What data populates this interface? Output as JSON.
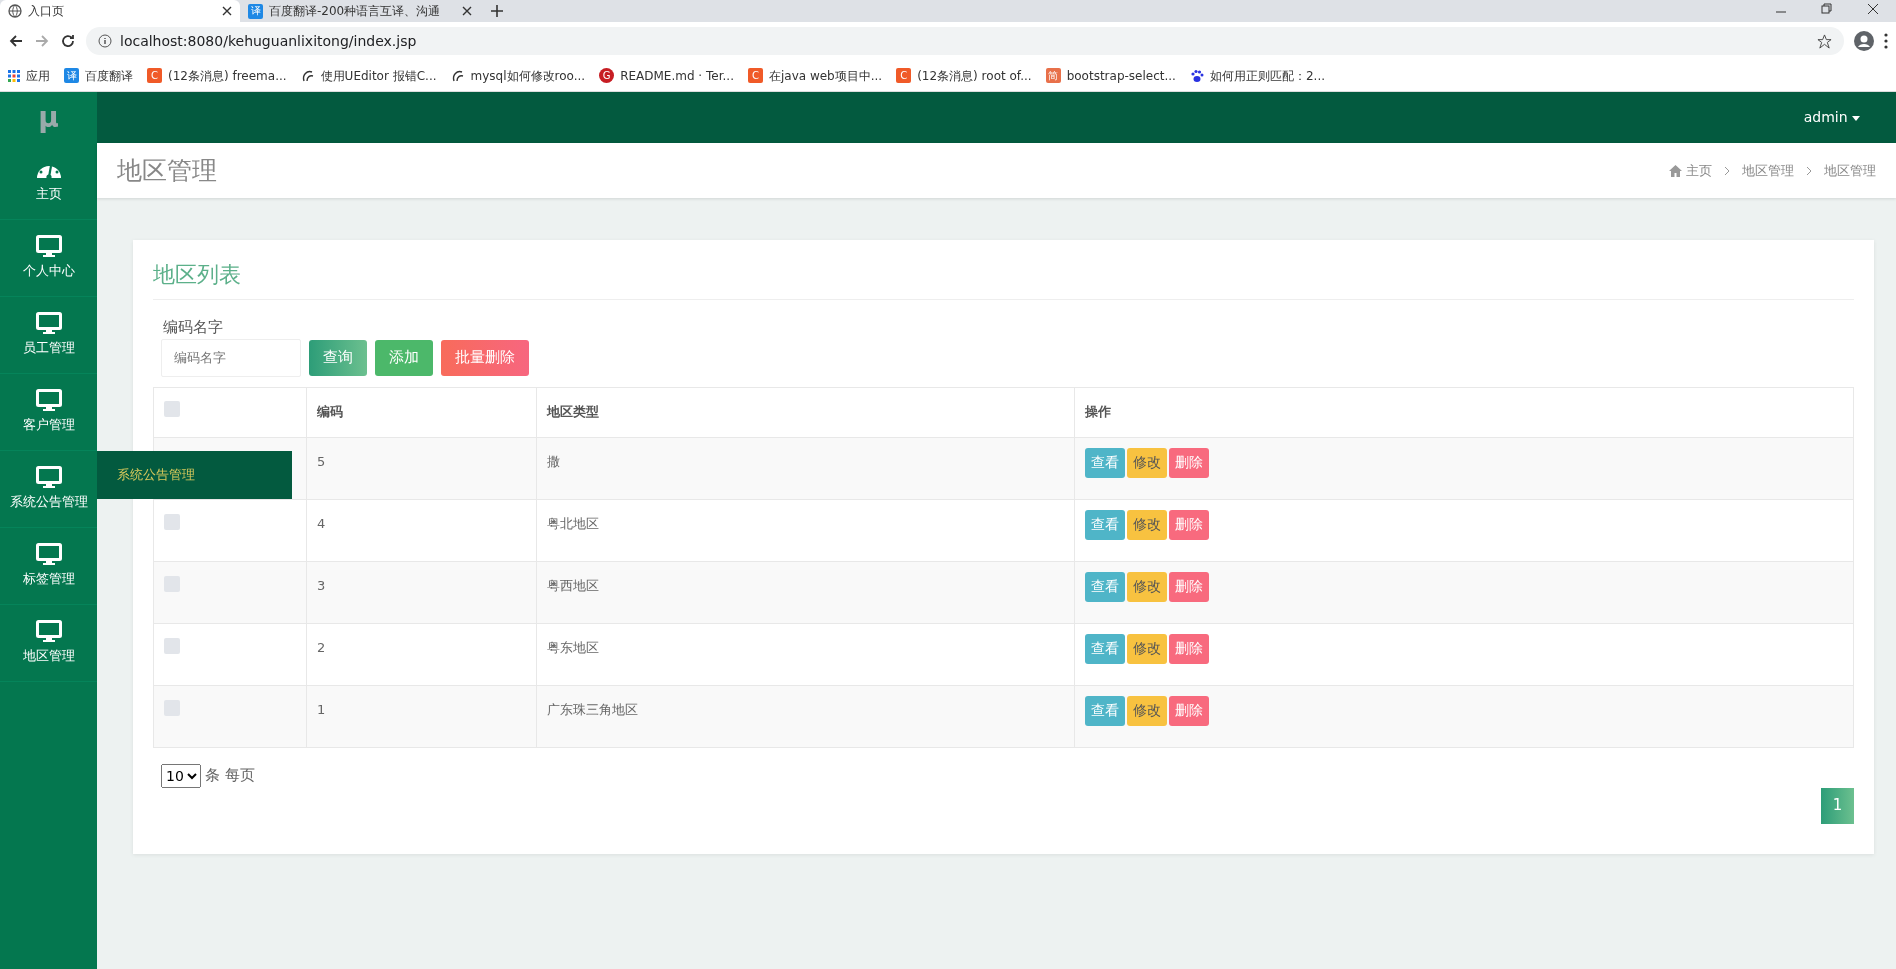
{
  "browser": {
    "tabs": [
      {
        "label": "入口页",
        "kind": "globe",
        "selected": true
      },
      {
        "label": "百度翻译-200种语言互译、沟通",
        "kind": "letter",
        "icon_text": "译",
        "selected": false
      }
    ],
    "address": "localhost:8080/kehuguanlixitong/index.jsp",
    "bookmarks": [
      {
        "kind": "grid",
        "label": "应用"
      },
      {
        "kind": "letter",
        "icon_text": "译",
        "color": "#1e88e5",
        "label": "百度翻译"
      },
      {
        "kind": "letter",
        "icon_text": "C",
        "color": "#f05a28",
        "label": "(12条消息) freema..."
      },
      {
        "kind": "ueditor",
        "label": "使用UEditor 报错C..."
      },
      {
        "kind": "ueditor",
        "label": "mysql如何修改roo..."
      },
      {
        "kind": "circle",
        "icon_text": "G",
        "color": "#c71d23",
        "label": "README.md · Ter..."
      },
      {
        "kind": "letter",
        "icon_text": "C",
        "color": "#f05a28",
        "label": "在java web项目中..."
      },
      {
        "kind": "letter",
        "icon_text": "C",
        "color": "#f05a28",
        "label": "(12条消息) root of..."
      },
      {
        "kind": "letter",
        "icon_text": "简",
        "color": "#e8704a",
        "label": "bootstrap-select..."
      },
      {
        "kind": "paw",
        "label": "如何用正则匹配：2..."
      }
    ]
  },
  "app": {
    "logo": "μ",
    "user": "admin",
    "sidebar": [
      {
        "kind": "dashboard",
        "label": "主页"
      },
      {
        "kind": "monitor",
        "label": "个人中心"
      },
      {
        "kind": "monitor",
        "label": "员工管理"
      },
      {
        "kind": "monitor",
        "label": "客户管理"
      },
      {
        "kind": "monitor",
        "label": "系统公告管理"
      },
      {
        "kind": "monitor",
        "label": "标签管理"
      },
      {
        "kind": "monitor",
        "label": "地区管理"
      }
    ],
    "flyout": "系统公告管理",
    "page_title": "地区管理",
    "breadcrumb": [
      "主页",
      "地区管理",
      "地区管理"
    ],
    "card": {
      "title": "地区列表",
      "search_label": "编码名字",
      "search": {
        "placeholder": "编码名字"
      },
      "buttons": [
        {
          "kind": "query",
          "label": "查询"
        },
        {
          "kind": "add",
          "label": "添加"
        },
        {
          "kind": "batch_delete",
          "label": "批量删除"
        }
      ],
      "table": {
        "header_checked": false,
        "columns": [
          "编码",
          "地区类型",
          "操作"
        ],
        "rows": [
          {
            "code": "5",
            "type": "撒",
            "actions": [
              {
                "kind": "view",
                "label": "查看"
              },
              {
                "kind": "edit",
                "label": "修改"
              },
              {
                "kind": "delete",
                "label": "删除"
              }
            ]
          },
          {
            "checked": false,
            "code": "4",
            "type": "粤北地区",
            "actions": [
              {
                "kind": "view",
                "label": "查看"
              },
              {
                "kind": "edit",
                "label": "修改"
              },
              {
                "kind": "delete",
                "label": "删除"
              }
            ]
          },
          {
            "checked": false,
            "code": "3",
            "type": "粤西地区",
            "actions": [
              {
                "kind": "view",
                "label": "查看"
              },
              {
                "kind": "edit",
                "label": "修改"
              },
              {
                "kind": "delete",
                "label": "删除"
              }
            ]
          },
          {
            "checked": false,
            "code": "2",
            "type": "粤东地区",
            "actions": [
              {
                "kind": "view",
                "label": "查看"
              },
              {
                "kind": "edit",
                "label": "修改"
              },
              {
                "kind": "delete",
                "label": "删除"
              }
            ]
          },
          {
            "checked": false,
            "code": "1",
            "type": "广东珠三角地区",
            "actions": [
              {
                "kind": "view",
                "label": "查看"
              },
              {
                "kind": "edit",
                "label": "修改"
              },
              {
                "kind": "delete",
                "label": "删除"
              }
            ]
          }
        ]
      },
      "page_size": "10",
      "page_size_label": "条 每页",
      "pages": [
        {
          "label": "1",
          "selected": true
        }
      ]
    }
  }
}
